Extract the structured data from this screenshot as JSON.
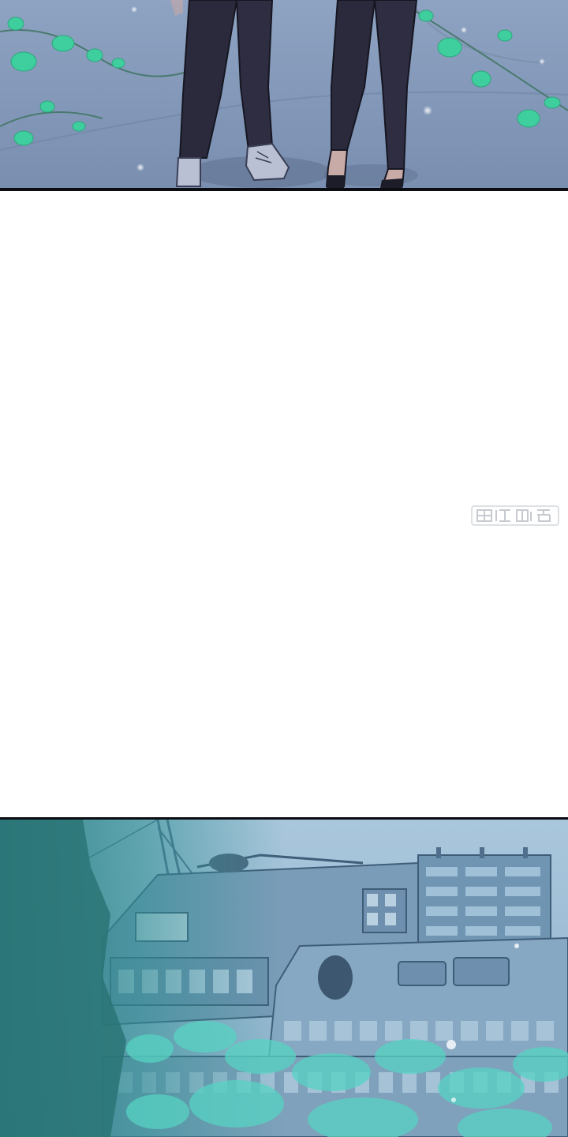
{
  "comic": {
    "panels": [
      {
        "id": "panel-1",
        "scene": "legs-scene"
      },
      {
        "id": "panel-2",
        "scene": "cityscape-scene"
      }
    ],
    "watermark_text": "",
    "colors": {
      "night_blue": "#7f95b4",
      "vine_green": "#3fcf9e",
      "jeans": "#2b2a3c",
      "panel_border": "#0c0d12",
      "building_blue": "#6e97b3",
      "haze_teal": "#2f8f93"
    }
  }
}
